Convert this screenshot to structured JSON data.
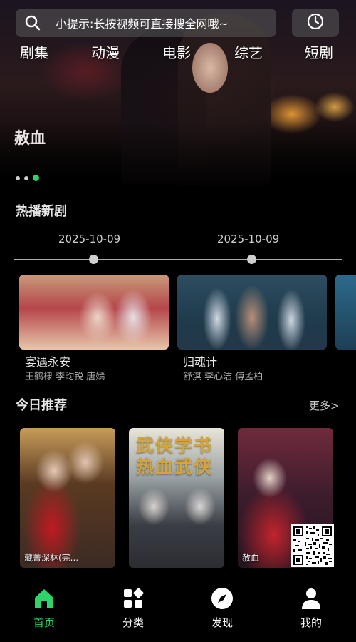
{
  "search": {
    "placeholder_text": "小提示:长按视频可直接搜全网哦~"
  },
  "categories": [
    {
      "label": "剧集"
    },
    {
      "label": "动漫"
    },
    {
      "label": "电影"
    },
    {
      "label": "综艺"
    },
    {
      "label": "短剧"
    }
  ],
  "hero": {
    "title": "赦血",
    "dots": 3,
    "active_dot": 3
  },
  "hot_section": {
    "title": "热播新剧",
    "dates": [
      "2025-10-09",
      "2025-10-09"
    ],
    "items": [
      {
        "name": "宴遇永安",
        "cast": "王鹤棣 李昀锐 唐嫣"
      },
      {
        "name": "归魂计",
        "cast": "舒淇 李心洁 傅孟柏"
      }
    ]
  },
  "recommend_section": {
    "title": "今日推荐",
    "more": "更多>",
    "posters": [
      {
        "caption": "藏菁深林(完..."
      },
      {
        "headline": "武侠学书 热血武侠",
        "caption": ""
      },
      {
        "caption": "赦血"
      }
    ]
  },
  "nav": [
    {
      "label": "首页",
      "icon": "home-icon",
      "active": true
    },
    {
      "label": "分类",
      "icon": "category-icon",
      "active": false
    },
    {
      "label": "发现",
      "icon": "compass-icon",
      "active": false
    },
    {
      "label": "我的",
      "icon": "user-icon",
      "active": false
    }
  ],
  "colors": {
    "accent": "#2ed36a",
    "background": "#000000"
  }
}
